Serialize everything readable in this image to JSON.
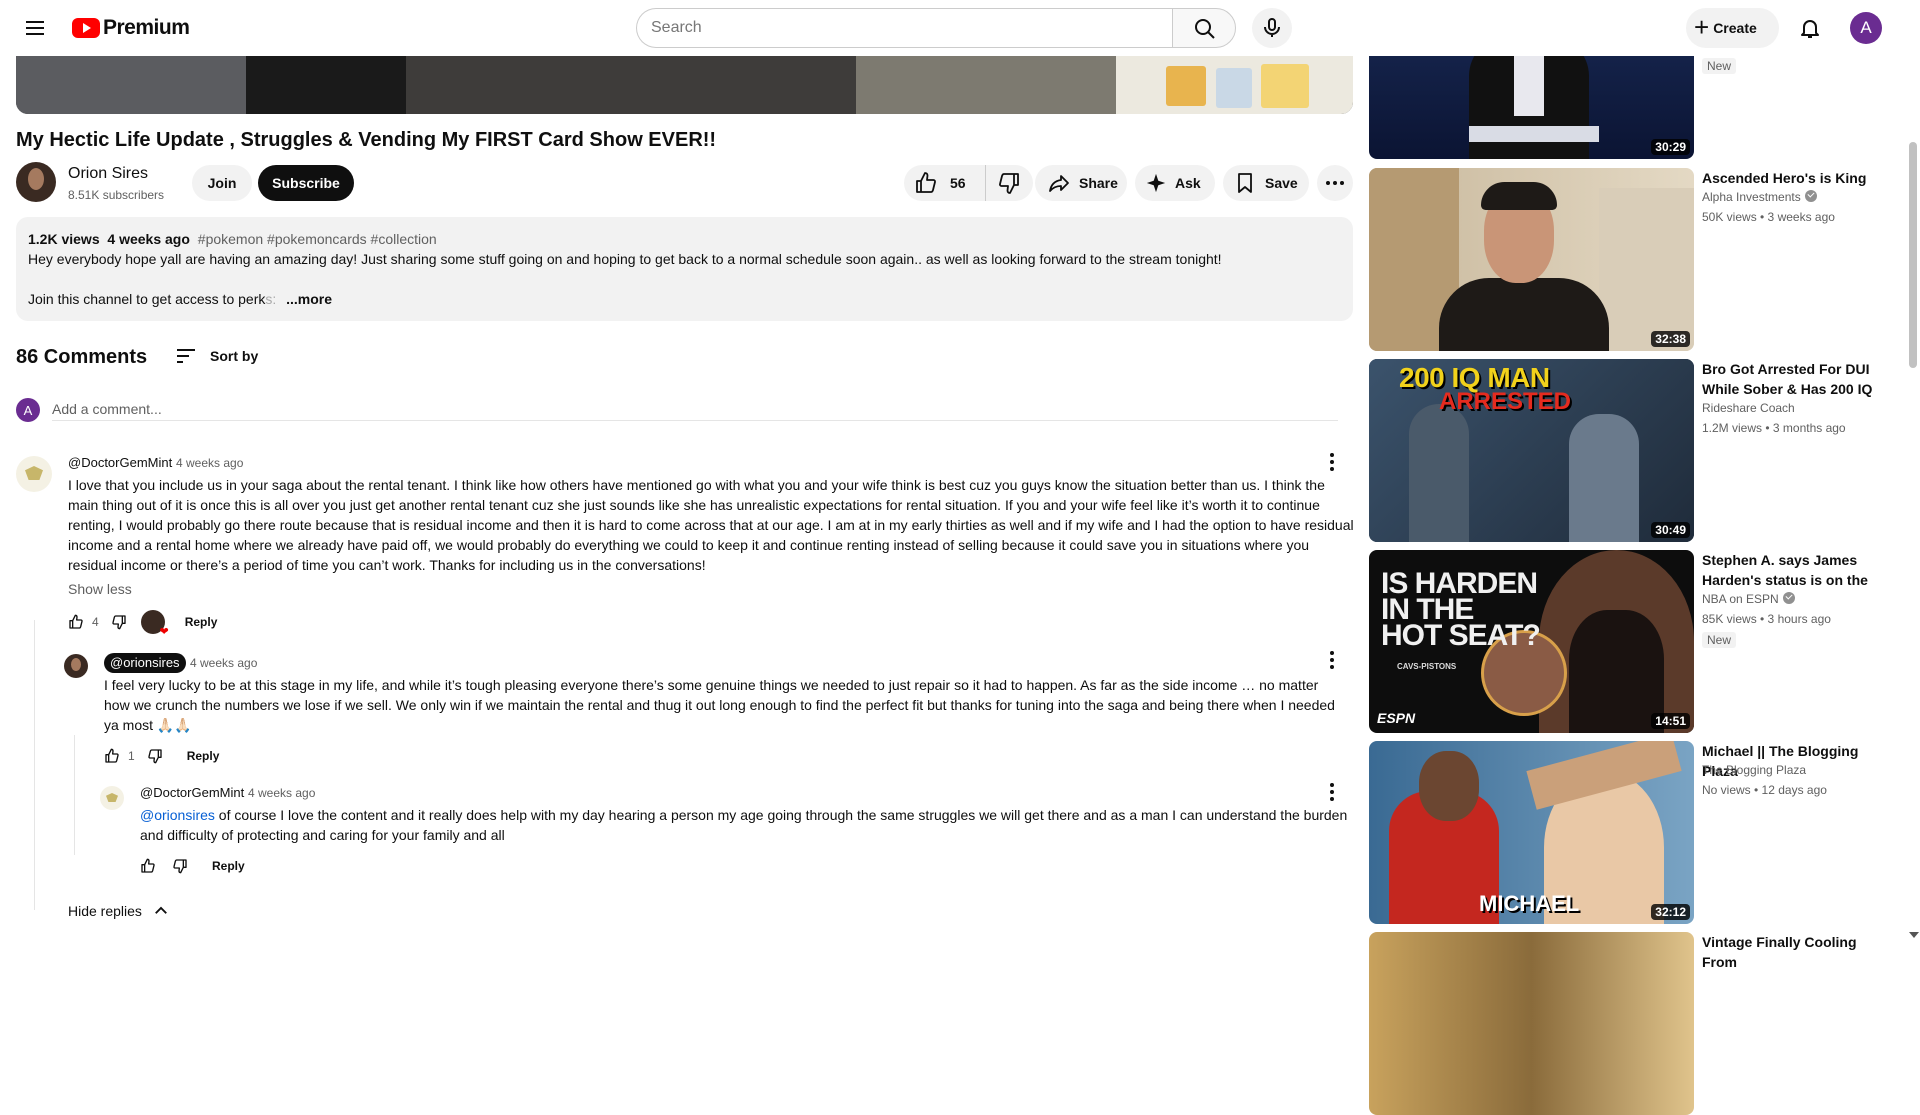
{
  "header": {
    "logo_text": "Premium",
    "search_placeholder": "Search",
    "create_label": "Create",
    "avatar_letter": "A"
  },
  "video": {
    "title": "My Hectic Life Update , Struggles & Vending My FIRST Card Show EVER!!",
    "channel_name": "Orion Sires",
    "subscribers": "8.51K subscribers",
    "join_label": "Join",
    "subscribe_label": "Subscribe",
    "likes": "56",
    "share_label": "Share",
    "ask_label": "Ask",
    "save_label": "Save"
  },
  "description": {
    "views": "1.2K views",
    "age": "4 weeks ago",
    "tags": "#pokemon #pokemoncards #collection",
    "line1": "Hey everybody hope yall are having an amazing day! Just sharing some stuff going on and hoping to get back to a normal schedule soon again.. as well as looking forward to the stream tonight!",
    "line2_start": "Join this channel to get access to perk",
    "line2_fade": "s:",
    "more_label": "...more"
  },
  "comments_section": {
    "count_label": "86 Comments",
    "sort_label": "Sort by",
    "add_placeholder": "Add a comment...",
    "avatar_letter": "A"
  },
  "comments": [
    {
      "author": "@DoctorGemMint",
      "time": "4 weeks ago",
      "text": "I love that you include us in your saga about the rental tenant. I think like how others have mentioned go with what you and your wife think is best cuz you guys know the situation better than us. I think the main thing out of it is once this is all over you just get another rental tenant cuz she just sounds like she has unrealistic expectations for rental situation. If you and your wife feel like it’s worth it to continue renting, I would probably go there route because that is residual income and then it is hard to come across that at our age. I am at in my early thirties as well and if my wife and I had the option to have residual income and a rental home where we already have paid off, we would probably do everything we could to keep it and continue renting instead of selling because it could save you in situations where you residual income or there’s a period of time you can’t work. Thanks for including us in the conversations!",
      "show_less": "Show less",
      "likes": "4",
      "reply_label": "Reply"
    },
    {
      "author": "@orionsires",
      "time": "4 weeks ago",
      "text": "I feel very lucky to be at this stage in my life, and while it’s tough pleasing everyone there’s some genuine things we needed to just repair so it had to happen. As far as the side income … no matter how we crunch the numbers we lose if we sell. We only win if we maintain the rental and thug it out long enough to find the perfect fit but thanks for tuning into the saga and being there when I needed ya most 🙏🏻🙏🏻",
      "likes": "1",
      "reply_label": "Reply"
    },
    {
      "author": "@DoctorGemMint",
      "time": "4 weeks ago",
      "mention": "@orionsires",
      "text": " of course I love the content and it really does help with my day hearing a person my age going through the same struggles we will get there and as a man I can understand the burden and difficulty of protecting and caring for your family and all",
      "reply_label": "Reply"
    }
  ],
  "hide_replies_label": "Hide replies",
  "related": [
    {
      "title": "",
      "channel": "",
      "meta": "",
      "badge": "New",
      "duration": "30:29",
      "verified": false,
      "colors": [
        "#1b2d5a",
        "#0b1433",
        "#d9dce5"
      ]
    },
    {
      "title": "Ascended Hero's is King",
      "channel": "Alpha Investments",
      "meta": "50K views • 3 weeks ago",
      "badge": "",
      "duration": "32:38",
      "verified": true,
      "colors": [
        "#d9cdb8",
        "#b59a72",
        "#1e1a17"
      ]
    },
    {
      "title": "Bro Got Arrested For DUI While Sober & Has 200 IQ",
      "channel": "Rideshare Coach",
      "meta": "1.2M views • 3 months ago",
      "badge": "",
      "duration": "30:49",
      "verified": false,
      "colors": [
        "#2d3f55",
        "#f2d21b",
        "#e52b1f"
      ]
    },
    {
      "title": "Stephen A. says James Harden's status is on the …",
      "channel": "NBA on ESPN",
      "meta": "85K views • 3 hours ago",
      "badge": "New",
      "duration": "14:51",
      "verified": true,
      "colors": [
        "#0d0d0d",
        "#5b3a2a",
        "#f0f0f0"
      ]
    },
    {
      "title": "Michael || The Blogging Plaza",
      "channel": "The Blogging Plaza",
      "meta": "No views • 12 days ago",
      "badge": "",
      "duration": "32:12",
      "verified": false,
      "colors": [
        "#3a6a93",
        "#c4271f",
        "#e9c8a6"
      ]
    },
    {
      "title": "Vintage Finally Cooling From",
      "channel": "",
      "meta": "",
      "badge": "",
      "duration": "",
      "verified": false,
      "colors": [
        "#c8a25d",
        "#8a6b3b",
        "#e0c48c"
      ]
    }
  ],
  "thumb_texts": {
    "r2_line1": "200 IQ MAN",
    "r2_line2": "ARRESTED",
    "r3_line1": "IS HARDEN",
    "r3_line2": "IN THE",
    "r3_line3": "HOT SEAT?",
    "r3_small": "CAVS-PISTONS",
    "r3_logo": "ESPN",
    "r4_word": "MICHAEL"
  }
}
